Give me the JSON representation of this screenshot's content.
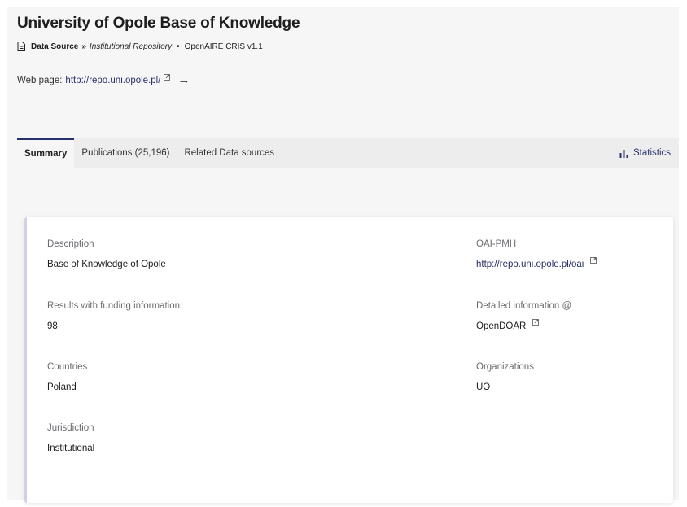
{
  "header": {
    "title": "University of Opole Base of Knowledge",
    "source_link": "Data Source",
    "separator": "»",
    "subtype": "Institutional Repository",
    "dot": "•",
    "compat": "OpenAIRE CRIS v1.1"
  },
  "webpage": {
    "label": "Web page:",
    "url": "http://repo.uni.opole.pl/",
    "arrow": "→"
  },
  "tabs": [
    {
      "label": "Summary",
      "active": true
    },
    {
      "label": "Publications (25,196)",
      "active": false
    },
    {
      "label": "Related Data sources",
      "active": false
    }
  ],
  "statistics_label": "Statistics",
  "fields": {
    "description": {
      "label": "Description",
      "value": "Base of Knowledge of Opole"
    },
    "oai_pmh": {
      "label": "OAI-PMH",
      "value": "http://repo.uni.opole.pl/oai"
    },
    "funding": {
      "label": "Results with funding information",
      "value": "98"
    },
    "detailed": {
      "label": "Detailed information @",
      "value": "OpenDOAR"
    },
    "countries": {
      "label": "Countries",
      "value": "Poland"
    },
    "organizations": {
      "label": "Organizations",
      "value": "UO"
    },
    "jurisdiction": {
      "label": "Jurisdiction",
      "value": "Institutional"
    }
  },
  "colors": {
    "accent": "#26306a",
    "card_border": "#cfd2e6",
    "page_bg": "#f6f6f7",
    "tab_bg": "#ededee"
  },
  "icons": {
    "doc": "document-icon",
    "external": "external-link-icon",
    "bars": "bar-chart-icon"
  }
}
